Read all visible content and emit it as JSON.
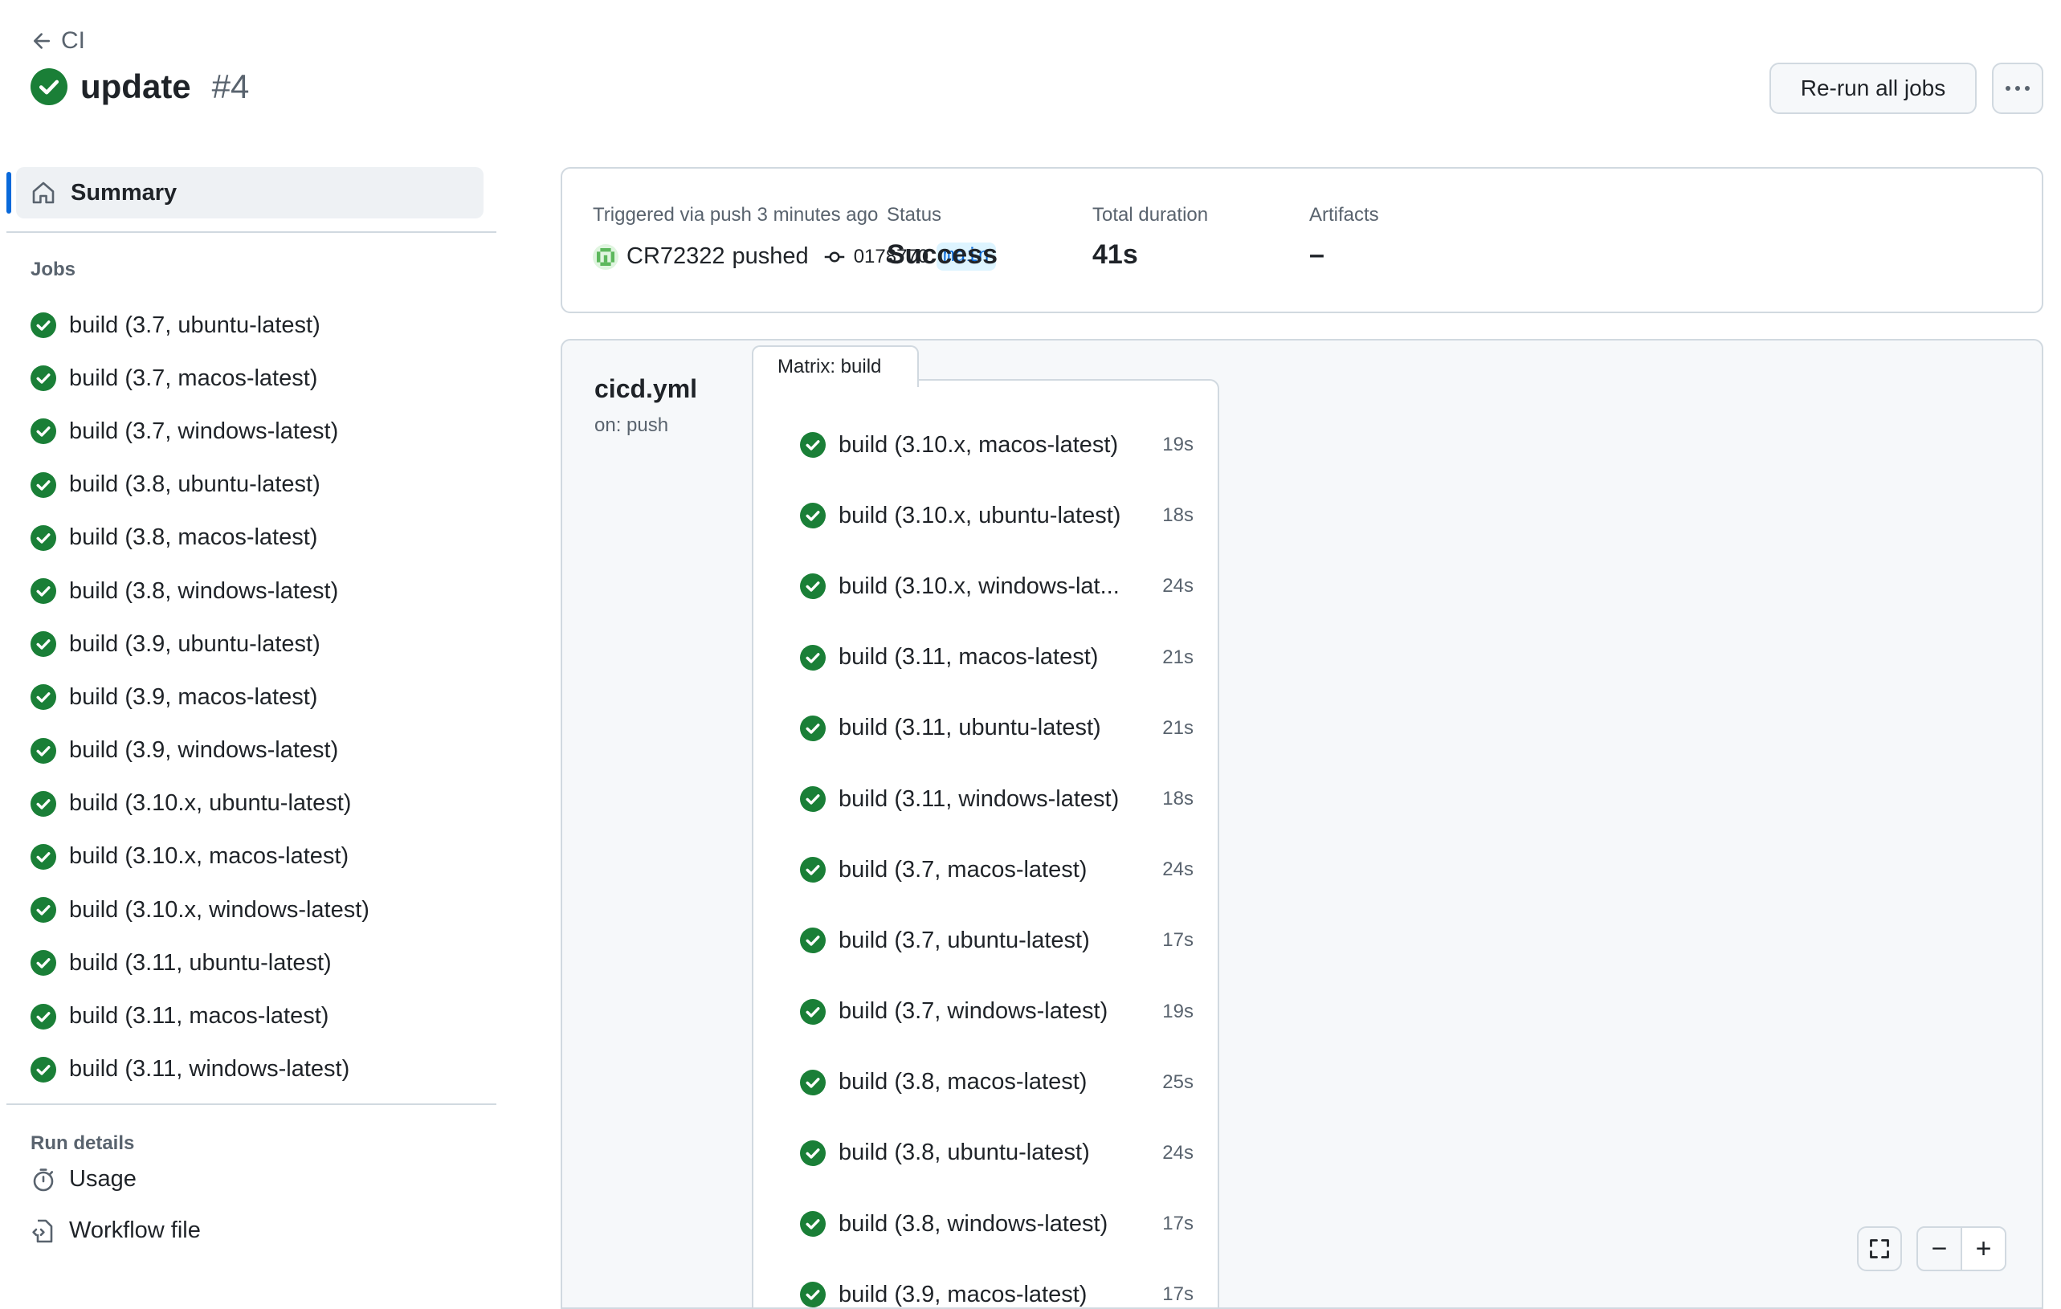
{
  "header": {
    "back_label": "CI",
    "run_title": "update",
    "run_number": "#4",
    "rerun_label": "Re-run all jobs",
    "more_label": "···"
  },
  "sidebar": {
    "summary_label": "Summary",
    "jobs_heading": "Jobs",
    "jobs": [
      "build (3.7, ubuntu-latest)",
      "build (3.7, macos-latest)",
      "build (3.7, windows-latest)",
      "build (3.8, ubuntu-latest)",
      "build (3.8, macos-latest)",
      "build (3.8, windows-latest)",
      "build (3.9, ubuntu-latest)",
      "build (3.9, macos-latest)",
      "build (3.9, windows-latest)",
      "build (3.10.x, ubuntu-latest)",
      "build (3.10.x, macos-latest)",
      "build (3.10.x, windows-latest)",
      "build (3.11, ubuntu-latest)",
      "build (3.11, macos-latest)",
      "build (3.11, windows-latest)"
    ],
    "run_details_heading": "Run details",
    "usage_label": "Usage",
    "workflow_file_label": "Workflow file"
  },
  "trigger": {
    "triggered_text": "Triggered via push 3 minutes ago",
    "user": "CR72322",
    "pushed_text": "pushed",
    "commit_sha": "0178770",
    "branch": "main",
    "status_label": "Status",
    "status_value": "Success",
    "duration_label": "Total duration",
    "duration_value": "41s",
    "artifacts_label": "Artifacts",
    "artifacts_value": "–"
  },
  "graph": {
    "workflow_file": "cicd.yml",
    "trigger_event": "on: push",
    "matrix_tab": "Matrix: build",
    "matrix_jobs": [
      {
        "name": "build (3.10.x, macos-latest)",
        "duration": "19s"
      },
      {
        "name": "build (3.10.x, ubuntu-latest)",
        "duration": "18s"
      },
      {
        "name": "build (3.10.x, windows-lat...",
        "duration": "24s"
      },
      {
        "name": "build (3.11, macos-latest)",
        "duration": "21s"
      },
      {
        "name": "build (3.11, ubuntu-latest)",
        "duration": "21s"
      },
      {
        "name": "build (3.11, windows-latest)",
        "duration": "18s"
      },
      {
        "name": "build (3.7, macos-latest)",
        "duration": "24s"
      },
      {
        "name": "build (3.7, ubuntu-latest)",
        "duration": "17s"
      },
      {
        "name": "build (3.7, windows-latest)",
        "duration": "19s"
      },
      {
        "name": "build (3.8, macos-latest)",
        "duration": "25s"
      },
      {
        "name": "build (3.8, ubuntu-latest)",
        "duration": "24s"
      },
      {
        "name": "build (3.8, windows-latest)",
        "duration": "17s"
      },
      {
        "name": "build (3.9, macos-latest)",
        "duration": "17s"
      }
    ],
    "zoom_out_label": "−",
    "zoom_in_label": "+"
  },
  "colors": {
    "success": "#1a7f37",
    "accent": "#0969da",
    "border": "#d1d9e0",
    "muted_text": "#59636e"
  },
  "icons": [
    "arrow-left-icon",
    "check-circle-icon",
    "home-icon",
    "stopwatch-icon",
    "file-code-icon",
    "commit-icon",
    "fullscreen-icon",
    "kebab-icon"
  ]
}
